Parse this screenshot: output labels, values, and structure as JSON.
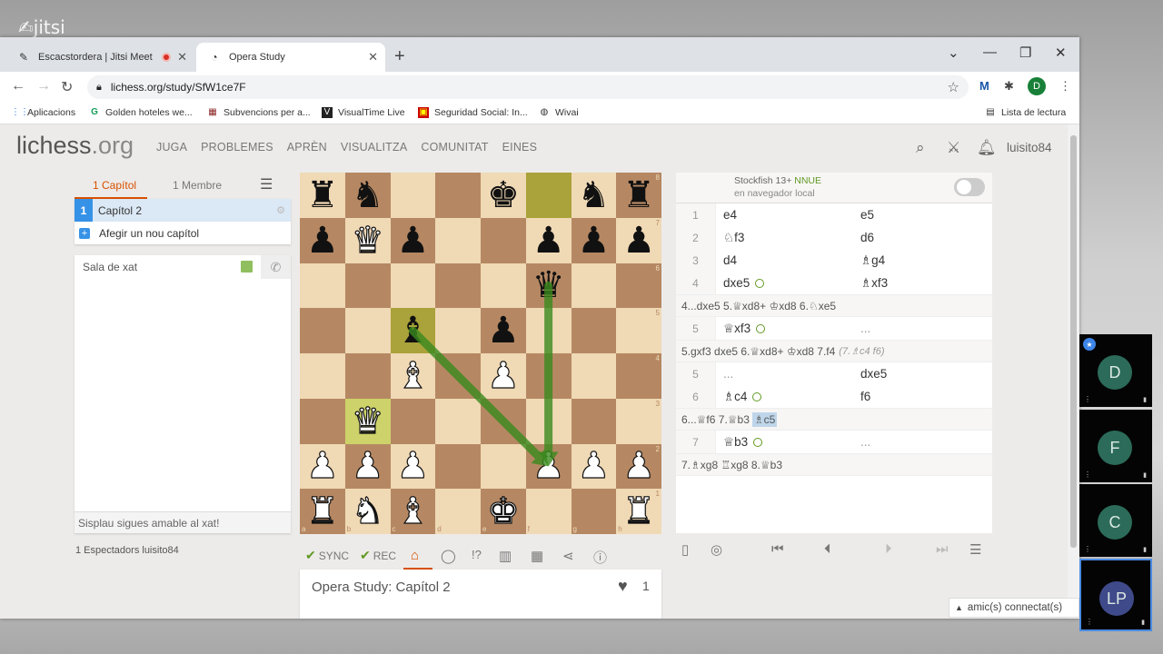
{
  "jitsi_logo": "jitsi",
  "browser": {
    "tabs": [
      {
        "label": "Escacstordera | Jitsi Meet",
        "icon": "jitsi-feather-icon"
      },
      {
        "label": "Opera Study",
        "icon": "lichess-icon"
      }
    ],
    "url": "lichess.org/study/SfW1ce7F",
    "profile_initial": "D",
    "bookmarks": [
      {
        "label": "Aplicacions",
        "icon": "apps-grid-icon"
      },
      {
        "label": "Golden hoteles we...",
        "icon": "g-icon"
      },
      {
        "label": "Subvencions per a...",
        "icon": "building-icon"
      },
      {
        "label": "VisualTime Live",
        "icon": "visualtime-icon"
      },
      {
        "label": "Seguridad Social: In...",
        "icon": "seguridad-social-icon"
      },
      {
        "label": "Wivai",
        "icon": "globe-icon"
      }
    ],
    "reading_list": "Lista de lectura"
  },
  "lichess": {
    "logo_main": "lichess",
    "logo_ext": ".org",
    "nav": [
      "JUGA",
      "PROBLEMES",
      "APRÈN",
      "VISUALITZA",
      "COMUNITAT",
      "EINES"
    ],
    "username": "luisito84"
  },
  "left_panel": {
    "tab_chapters": "1 Capítol",
    "tab_members": "1 Membre",
    "chapter_number": "1",
    "chapter_name": "Capítol 2",
    "add_chapter": "Afegir un nou capítol",
    "chat_title": "Sala de xat",
    "chat_placeholder": "Sisplau sigues amable al xat!",
    "spectators": "1 Espectadors luisito84"
  },
  "board": {
    "ranks": [
      "8",
      "7",
      "6",
      "5",
      "4",
      "3",
      "2",
      "1"
    ],
    "files": [
      "a",
      "b",
      "c",
      "d",
      "e",
      "f",
      "g",
      "h"
    ],
    "position": [
      [
        "bR",
        "bN",
        "",
        "",
        "bK",
        "",
        "bN",
        "bR"
      ],
      [
        "bP",
        "wQ",
        "bP",
        "",
        "",
        "bP",
        "bP",
        "bP"
      ],
      [
        "",
        "",
        "",
        "",
        "",
        "bQ",
        "",
        ""
      ],
      [
        "",
        "",
        "bB",
        "",
        "bP",
        "",
        "",
        ""
      ],
      [
        "",
        "",
        "wB",
        "",
        "wP",
        "",
        "",
        ""
      ],
      [
        "",
        "wQ",
        "",
        "",
        "",
        "",
        "",
        ""
      ],
      [
        "wP",
        "wP",
        "wP",
        "",
        "",
        "wP",
        "wP",
        "wP"
      ],
      [
        "wR",
        "wN",
        "wB",
        "",
        "wK",
        "",
        "",
        "wR"
      ]
    ],
    "highlights": [
      {
        "square": "f8",
        "kind": "last-move"
      },
      {
        "square": "c5",
        "kind": "last-move"
      },
      {
        "square": "b3",
        "kind": "last-move"
      }
    ],
    "arrows": [
      {
        "from": "c5",
        "to": "f2",
        "color": "#3a8a1e"
      },
      {
        "from": "f6",
        "to": "f2",
        "color": "#3a8a1e"
      }
    ]
  },
  "tools": {
    "sync": "SYNC",
    "rec": "REC"
  },
  "study_name": "Opera Study: Capítol 2",
  "likes": "1",
  "ceval": {
    "engine": "Stockfish 13+",
    "nnue": "NNUE",
    "location": "en navegador local"
  },
  "moves": [
    {
      "type": "row",
      "n": "1",
      "white": "e4",
      "black": "e5"
    },
    {
      "type": "row",
      "n": "2",
      "white": "♘f3",
      "black": "d6"
    },
    {
      "type": "row",
      "n": "3",
      "white": "d4",
      "black": "♗g4"
    },
    {
      "type": "row",
      "n": "4",
      "white": "dxe5",
      "white_gly": true,
      "black": "♗xf3"
    },
    {
      "type": "var",
      "text": "4...dxe5 5.♕xd8+ ♔xd8 6.♘xe5"
    },
    {
      "type": "row",
      "n": "5",
      "white": "♕xf3",
      "white_gly": true,
      "black": "...",
      "black_dots": true
    },
    {
      "type": "var",
      "text": "5.gxf3 dxe5 6.♕xd8+ ♔xd8 7.f4",
      "comment": "(7.♗c4 f6)"
    },
    {
      "type": "row",
      "n": "5",
      "white": "...",
      "white_dots": true,
      "black": "dxe5"
    },
    {
      "type": "row",
      "n": "6",
      "white": "♗c4",
      "white_gly": true,
      "black": "f6"
    },
    {
      "type": "var",
      "text": "6...♕f6 7.♕b3",
      "current": "♗c5"
    },
    {
      "type": "row",
      "n": "7",
      "white": "♕b3",
      "white_gly": true,
      "black": "...",
      "black_dots": true
    },
    {
      "type": "var",
      "text": "7.♗xg8 ♖xg8 8.♕b3"
    }
  ],
  "friends_bar": "amic(s) connectat(s)",
  "participants": [
    {
      "initials": "D",
      "color": "#2c6b59"
    },
    {
      "initials": "F",
      "color": "#2c6b59"
    },
    {
      "initials": "C",
      "color": "#2c6b59"
    },
    {
      "initials": "LP",
      "color": "#3f4a8a"
    }
  ]
}
